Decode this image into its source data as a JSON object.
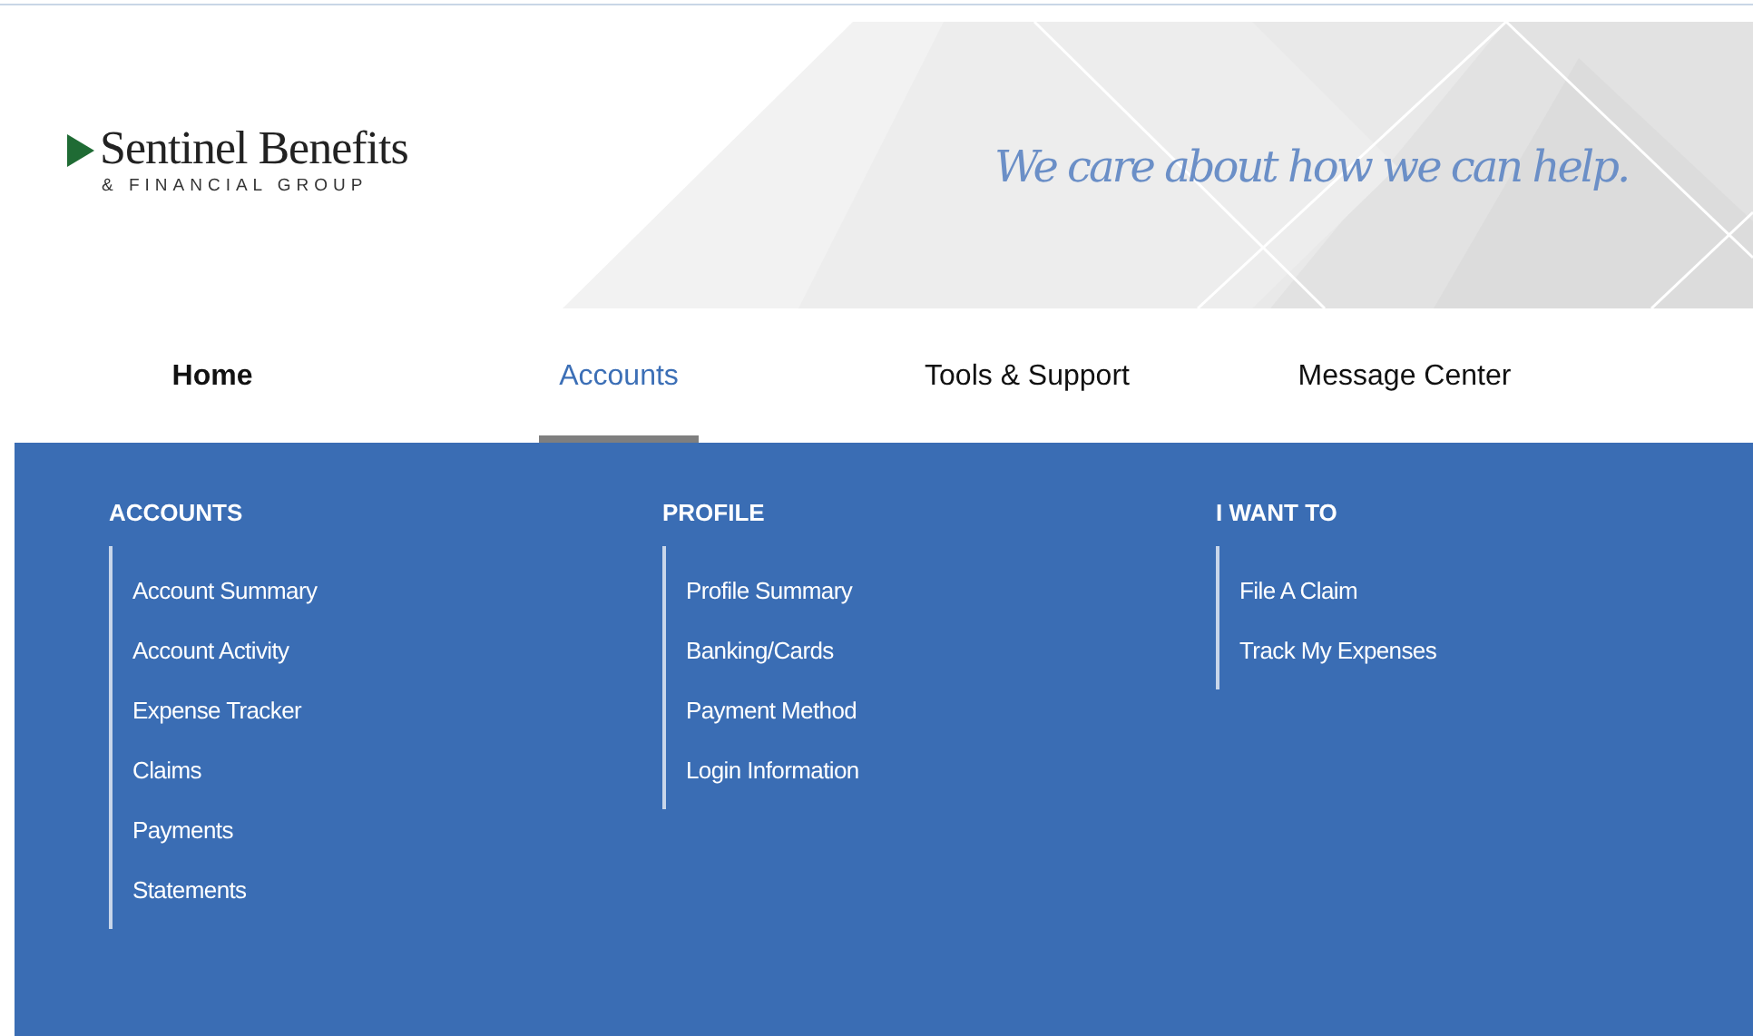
{
  "logo": {
    "name": "Sentinel Benefits",
    "subtitle": "& FINANCIAL GROUP"
  },
  "tagline": "We care about how we can help.",
  "nav": [
    {
      "label": "Home",
      "selected": false
    },
    {
      "label": "Accounts",
      "selected": true
    },
    {
      "label": "Tools & Support",
      "selected": false
    },
    {
      "label": "Message Center",
      "selected": false
    }
  ],
  "menu_columns": [
    {
      "heading": "ACCOUNTS",
      "items": [
        "Account Summary",
        "Account Activity",
        "Expense Tracker",
        "Claims",
        "Payments",
        "Statements"
      ]
    },
    {
      "heading": "PROFILE",
      "items": [
        "Profile Summary",
        "Banking/Cards",
        "Payment Method",
        "Login Information"
      ]
    },
    {
      "heading": "I WANT TO",
      "items": [
        "File A Claim",
        "Track My Expenses"
      ]
    }
  ]
}
